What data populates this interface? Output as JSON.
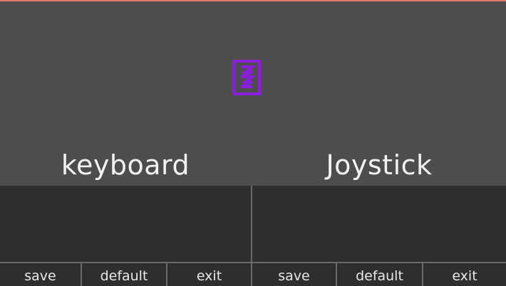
{
  "app": {
    "accent_color": "#e07a6a",
    "emblem_icon": "purple-device-icon",
    "emblem_color": "#8a1fd8"
  },
  "sections": {
    "keyboard": {
      "title": "keyboard"
    },
    "joystick": {
      "title": "Joystick"
    }
  },
  "left_buttons": {
    "save": "save",
    "default": "default",
    "exit": "exit"
  },
  "right_buttons": {
    "save": "save",
    "default": "default",
    "exit": "exit"
  }
}
